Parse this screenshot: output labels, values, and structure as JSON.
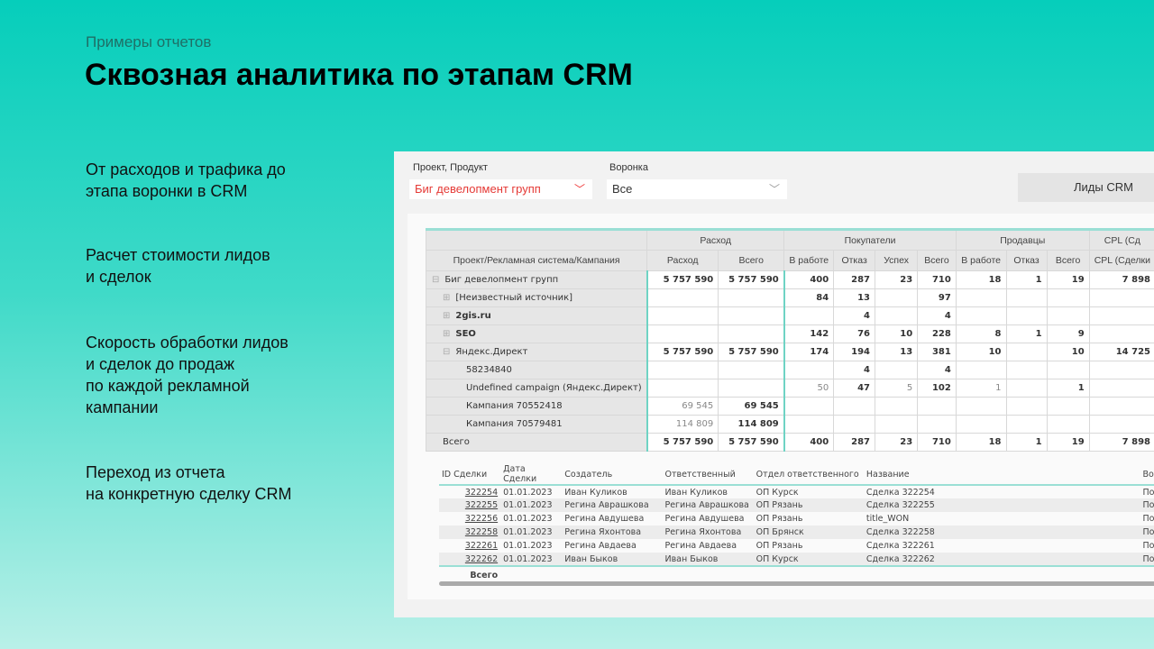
{
  "header": {
    "subtitle": "Примеры отчетов",
    "title": "Сквозная аналитика по этапам CRM"
  },
  "features": [
    "От расходов и трафика до\nэтапа воронки в CRM",
    "Расчет стоимости лидов\nи сделок",
    "Скорость обработки лидов\nи сделок до продаж\nпо каждой рекламной\nкампании",
    "Переход из отчета\nна конкретную сделку CRM"
  ],
  "filters": {
    "project_label": "Проект, Продукт",
    "project_value": "Биг девелопмент групп",
    "funnel_label": "Воронка",
    "funnel_value": "Все",
    "button": "Лиды CRM"
  },
  "colors": {
    "accent": "#0ccfbd",
    "selected_red": "#e53935"
  },
  "pivot": {
    "groups": [
      "Расход",
      "Покупатели",
      "Продавцы",
      "CPL (Сд"
    ],
    "columns": [
      "Проект/Рекламная система/Кампания",
      "Расход",
      "Всего",
      "В работе",
      "Отказ",
      "Успех",
      "Всего",
      "В работе",
      "Отказ",
      "Всего",
      "CPL (Сделки"
    ],
    "rows": [
      {
        "name": "Биг девелопмент групп",
        "icon": "minus",
        "indent": 0,
        "bold": false,
        "cells": [
          "5 757 590",
          "5 757 590",
          "400",
          "287",
          "23",
          "710",
          "18",
          "1",
          "19",
          "7 898"
        ]
      },
      {
        "name": "[Неизвестный источник]",
        "icon": "plus",
        "indent": 1,
        "bold": false,
        "cells": [
          "",
          "",
          "84",
          "13",
          "",
          "97",
          "",
          "",
          "",
          ""
        ]
      },
      {
        "name": "2gis.ru",
        "icon": "plus",
        "indent": 1,
        "bold": true,
        "cells": [
          "",
          "",
          "",
          "4",
          "",
          "4",
          "",
          "",
          "",
          ""
        ]
      },
      {
        "name": "SEO",
        "icon": "plus",
        "indent": 1,
        "bold": true,
        "cells": [
          "",
          "",
          "142",
          "76",
          "10",
          "228",
          "8",
          "1",
          "9",
          ""
        ]
      },
      {
        "name": "Яндекс.Директ",
        "icon": "minus",
        "indent": 1,
        "bold": false,
        "cells": [
          "5 757 590",
          "5 757 590",
          "174",
          "194",
          "13",
          "381",
          "10",
          "",
          "10",
          "14 725"
        ]
      },
      {
        "name": "58234840",
        "icon": "",
        "indent": 2,
        "bold": false,
        "cells": [
          "",
          "",
          "",
          "4",
          "",
          "4",
          "",
          "",
          "",
          ""
        ]
      },
      {
        "name": "Undefined campaign (Яндекс.Директ)",
        "icon": "",
        "indent": 2,
        "bold": false,
        "cells": [
          "",
          "",
          "50",
          "47",
          "5",
          "102",
          "1",
          "",
          "1",
          ""
        ]
      },
      {
        "name": "Кампания 70552418",
        "icon": "",
        "indent": 2,
        "bold": false,
        "cells": [
          "69 545",
          "69 545",
          "",
          "",
          "",
          "",
          "",
          "",
          "",
          ""
        ]
      },
      {
        "name": "Кампания 70579481",
        "icon": "",
        "indent": 2,
        "bold": false,
        "cells": [
          "114 809",
          "114 809",
          "",
          "",
          "",
          "",
          "",
          "",
          "",
          ""
        ]
      },
      {
        "name": "Всего",
        "icon": "",
        "indent": 1,
        "bold": false,
        "cells": [
          "5 757 590",
          "5 757 590",
          "400",
          "287",
          "23",
          "710",
          "18",
          "1",
          "19",
          "7 898"
        ]
      }
    ]
  },
  "deals": {
    "columns": [
      "ID Сделки",
      "Дата Сделки",
      "Создатель",
      "Ответственный",
      "Отдел ответственного",
      "Название",
      "Ворон"
    ],
    "rows": [
      [
        "322254",
        "01.01.2023",
        "Иван Куликов",
        "Иван Куликов",
        "ОП Курск",
        "Сделка 322254",
        "Покупа"
      ],
      [
        "322255",
        "01.01.2023",
        "Регина Аврашкова",
        "Регина Аврашкова",
        "ОП Рязань",
        "Сделка 322255",
        "Покупа"
      ],
      [
        "322256",
        "01.01.2023",
        "Регина Авдушева",
        "Регина Авдушева",
        "ОП Рязань",
        "title_WON",
        "Покупа"
      ],
      [
        "322258",
        "01.01.2023",
        "Регина Яхонтова",
        "Регина Яхонтова",
        "ОП Брянск",
        "Сделка 322258",
        "Покупа"
      ],
      [
        "322261",
        "01.01.2023",
        "Регина Авдаева",
        "Регина Авдаева",
        "ОП Рязань",
        "Сделка 322261",
        "Покупа"
      ],
      [
        "322262",
        "01.01.2023",
        "Иван Быков",
        "Иван Быков",
        "ОП Курск",
        "Сделка 322262",
        "Покупа"
      ]
    ],
    "total_label": "Всего"
  }
}
